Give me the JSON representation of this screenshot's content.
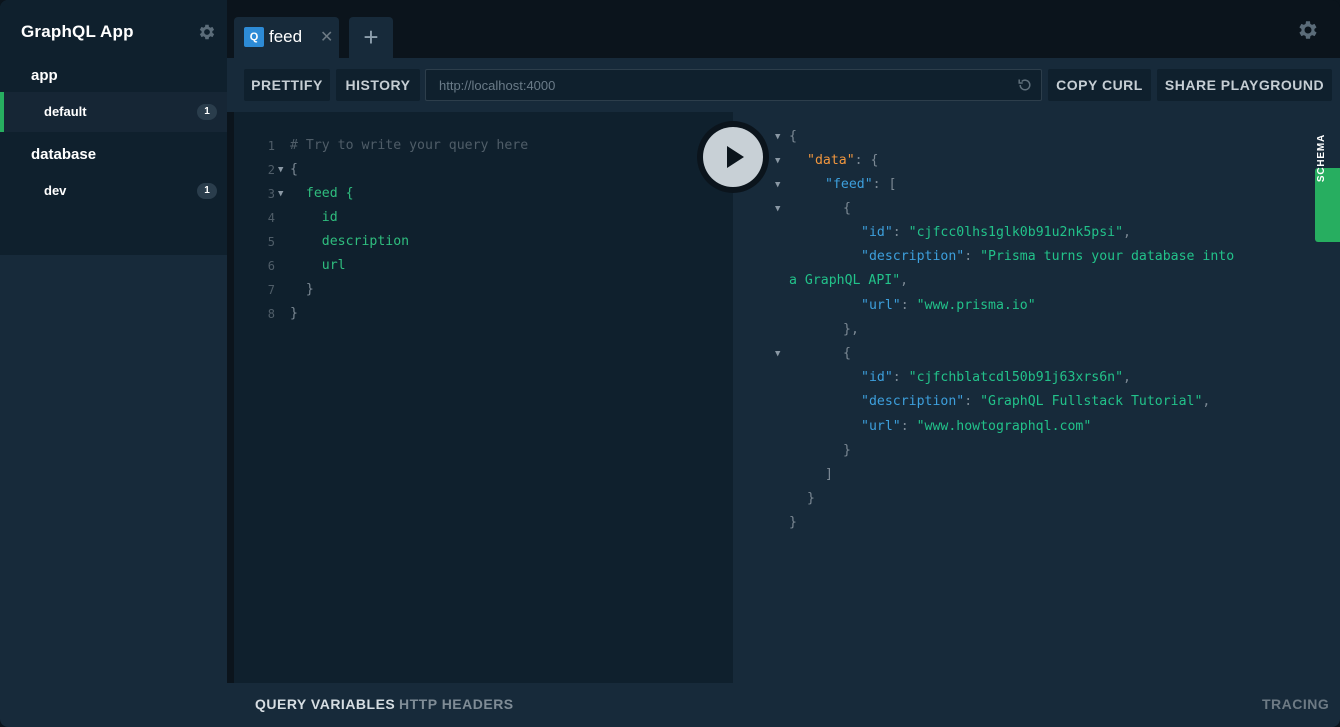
{
  "sidebar": {
    "title": "GraphQL App",
    "projects": [
      {
        "name": "app",
        "endpoints": [
          {
            "label": "default",
            "count": "1"
          }
        ]
      },
      {
        "name": "database",
        "endpoints": [
          {
            "label": "dev",
            "count": "1"
          }
        ]
      }
    ]
  },
  "tabs": [
    {
      "badge": "Q",
      "label": "feed",
      "close": "✕"
    }
  ],
  "tab_add": "+",
  "toolbar": {
    "prettify": "PRETTIFY",
    "history": "HISTORY",
    "url": "http://localhost:4000",
    "copy_curl": "COPY CURL",
    "share": "SHARE PLAYGROUND"
  },
  "editor": {
    "line_numbers": [
      "1",
      "2",
      "3",
      "4",
      "5",
      "6",
      "7",
      "8"
    ],
    "lines": [
      "# Try to write your query here",
      "{",
      "  feed {",
      "    id",
      "    description",
      "    url",
      "  }",
      "}"
    ]
  },
  "response": {
    "open_brace": "{",
    "data_key": "\"data\"",
    "feed_key": "\"feed\"",
    "colon": ": ",
    "comma": ",",
    "open_bracket": "[",
    "close_bracket": "]",
    "close_brace": "}",
    "close_brace_comma": "},",
    "id_key": "\"id\"",
    "description_key": "\"description\"",
    "url_key": "\"url\"",
    "items": [
      {
        "id": "\"cjfcc0lhs1glk0b91u2nk5psi\"",
        "description_part1": "\"Prisma turns your database into",
        "description_part2": "a GraphQL API\"",
        "url": "\"www.prisma.io\""
      },
      {
        "id": "\"cjfchblatcdl50b91j63xrs6n\"",
        "description": "\"GraphQL Fullstack Tutorial\"",
        "url": "\"www.howtographql.com\""
      }
    ]
  },
  "schema_tab": "SCHEMA",
  "bottom": {
    "query_variables": "QUERY VARIABLES",
    "http_headers": "HTTP HEADERS",
    "tracing": "TRACING"
  },
  "colors": {
    "accent_green": "#27ae60",
    "query_badge": "#2d8bd6",
    "string": "#22c28a",
    "key": "#3d9fdc",
    "data_key": "#f0963e"
  },
  "icons": {
    "settings": "gear-icon",
    "play": "play-icon",
    "reload": "reload-icon",
    "close": "close-icon",
    "add": "plus-icon",
    "fold": "fold-arrow-icon"
  }
}
